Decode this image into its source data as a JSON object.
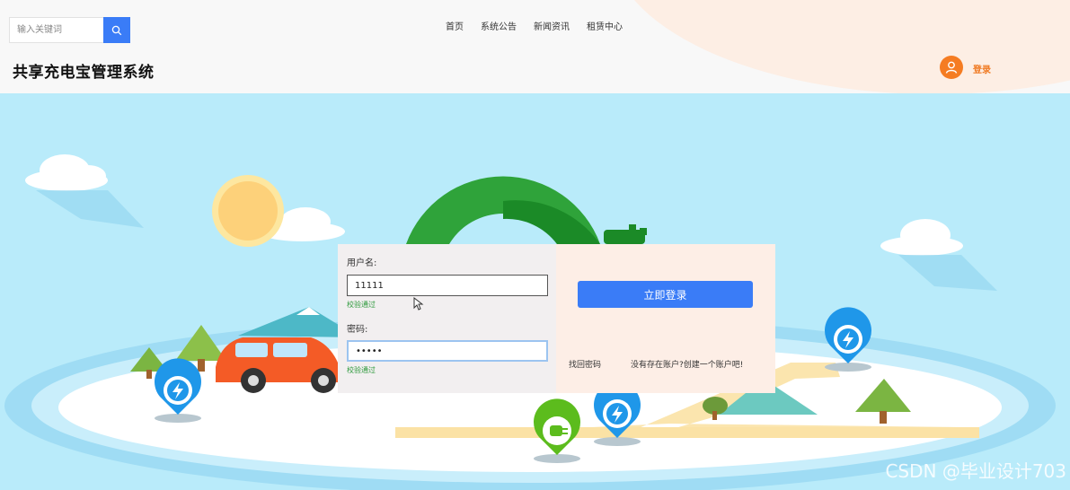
{
  "search": {
    "placeholder": "输入关键词"
  },
  "nav": {
    "items": [
      "首页",
      "系统公告",
      "新闻资讯",
      "租赁中心"
    ]
  },
  "site": {
    "title": "共享充电宝管理系统"
  },
  "user": {
    "login_label": "登录"
  },
  "form": {
    "username_label": "用户名:",
    "username_value": "11111",
    "username_hint": "校验通过",
    "password_label": "密码:",
    "password_value": "•••••",
    "password_hint": "校验通过",
    "submit_label": "立即登录",
    "forgot_label": "找回密码",
    "register_label": "没有存在账户?创建一个账户吧!"
  },
  "watermark": "CSDN @毕业设计703",
  "colors": {
    "accent": "#3a7cf7",
    "brand_orange": "#f57c22",
    "sky": "#b9ebfa",
    "valid_green": "#2f9a3d"
  }
}
